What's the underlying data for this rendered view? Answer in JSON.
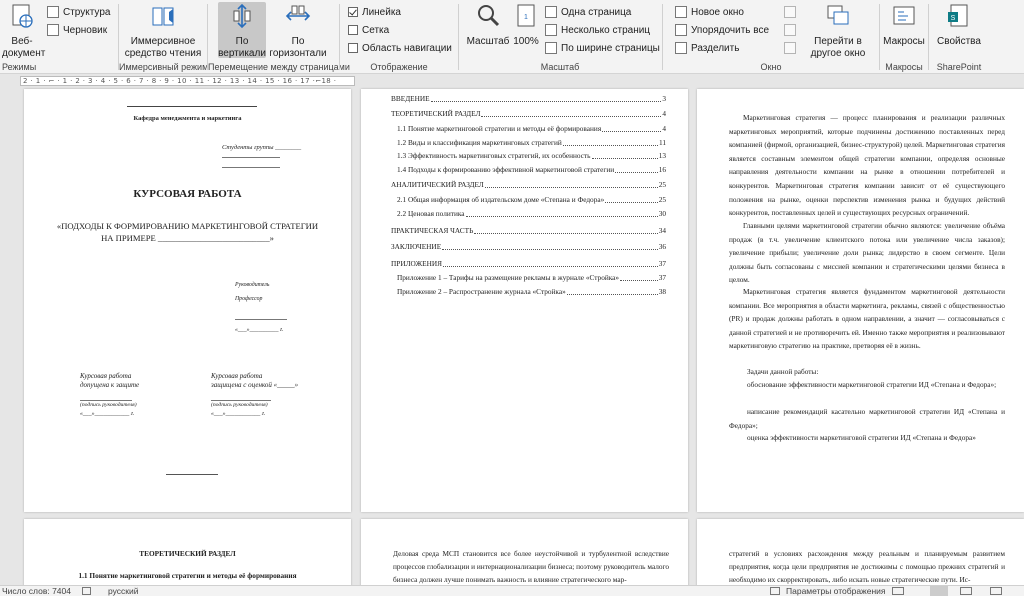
{
  "ribbon": {
    "modes": {
      "web_doc": "Веб-\nдокумент",
      "structure": "Структура",
      "draft": "Черновик",
      "group": "Режимы"
    },
    "immersive": {
      "reader": "Иммерсивное средство чтения",
      "group": "Иммерсивный режим"
    },
    "page_movement": {
      "vertical": "По вертикали",
      "horizontal": "По горизонтали",
      "group": "Перемещение между страницами"
    },
    "show": {
      "ruler": "Линейка",
      "grid": "Сетка",
      "nav_pane": "Область навигации",
      "group": "Отображение"
    },
    "zoom": {
      "zoom": "Масштаб",
      "hundred": "100%",
      "one_page": "Одна страница",
      "multiple_pages": "Несколько страниц",
      "page_width": "По ширине страницы",
      "group": "Масштаб"
    },
    "window": {
      "new_window": "Новое окно",
      "arrange_all": "Упорядочить все",
      "split": "Разделить",
      "switch_windows": "Перейти в другое окно",
      "group": "Окно"
    },
    "macros": {
      "macros": "Макросы",
      "group": "Макросы"
    },
    "sharepoint": {
      "properties": "Свойства",
      "group": "SharePoint"
    }
  },
  "ruler": {
    "text": "2 · 1 · ⌐ · 1 · 2 · 3 · 4 · 5 · 6 · 7 · 8 · 9 · 10 · 11 · 12 · 13 · 14 · 15 · 16 · 17 ·⌐18 ·"
  },
  "page1": {
    "dept": "Кафедра менеджмента и маркетинга",
    "student": "Студенты группы ________",
    "title": "КУРСОВАЯ РАБОТА",
    "topic_line1": "«ПОДХОДЫ К ФОРМИРОВАНИЮ МАРКЕТИНГОВОЙ СТРАТЕГИИ",
    "topic_line2": "НА ПРИМЕРЕ __________________________»",
    "supervisor": "Руководитель",
    "professor": "Профессор",
    "date_sig": "«___»__________ г.",
    "admitted_1": "Курсовая работа",
    "admitted_2": "допущена к защите",
    "defended_1": "Курсовая работа",
    "defended_2": "защищена с оценкой «_____»",
    "sup_sig_left": "(подпись руководителя)",
    "sup_sig_right": "(подпись руководителя)",
    "date_left": "«___»____________ г.",
    "date_right": "«___»____________ г."
  },
  "toc": [
    {
      "text": "ВВЕДЕНИЕ",
      "page": "3",
      "indent": 0
    },
    {
      "text": "ТЕОРЕТИЧЕСКИЙ РАЗДЕЛ",
      "page": "4",
      "indent": 0
    },
    {
      "text": "1.1 Понятие маркетинговой стратегии и методы её формирования",
      "page": "4",
      "indent": 1
    },
    {
      "text": "1.2 Виды и классификация маркетинговых стратегий",
      "page": "11",
      "indent": 1
    },
    {
      "text": "1.3 Эффективность маркетинговых стратегий, их особенность",
      "page": "13",
      "indent": 1
    },
    {
      "text": "1.4 Подходы к формированию эффективной маркетинговой стратегии",
      "page": "16",
      "indent": 1
    },
    {
      "text": "АНАЛИТИЧЕСКИЙ РАЗДЕЛ",
      "page": "25",
      "indent": 0
    },
    {
      "text": "2.1 Общая информация об издательском доме «Степана и Федора»",
      "page": "25",
      "indent": 1
    },
    {
      "text": "2.2 Ценовая политика",
      "page": "30",
      "indent": 1
    },
    {
      "text": "ПРАКТИЧЕСКАЯ ЧАСТЬ",
      "page": "34",
      "indent": 0
    },
    {
      "text": "ЗАКЛЮЧЕНИЕ",
      "page": "36",
      "indent": 0
    },
    {
      "text": "ПРИЛОЖЕНИЯ",
      "page": "37",
      "indent": 0
    },
    {
      "text": "Приложение 1 – Тарифы на размещение рекламы в журнале «Стройка»",
      "page": "37",
      "indent": 2
    },
    {
      "text": "Приложение 2 – Распространение журнала «Стройка»",
      "page": "38",
      "indent": 2
    }
  ],
  "page3": {
    "p1": "Маркетинговая стратегия — процесс планирования и реализации различных маркетинговых мероприятий, которые подчинены достижению поставленных перед компанией (фирмой, организацией, бизнес-структурой) целей. Маркетинговая стратегия является составным элементом общей стратегии компании, определяя основные направления деятельности компании на рынке в отношении потребителей и конкурентов. Маркетинговая стратегия компании зависит от её существующего положения на рынке, оценки перспектив изменения рынка и будущих действий конкурентов, поставленных целей и существующих ресурсных ограничений.",
    "p2": "Главными целями маркетинговой стратегии обычно являются: увеличение объёма продаж (в т.ч. увеличение клиентского потока или увеличение числа заказов); увеличение прибыли; увеличение доли рынка; лидерство в своем сегменте. Цели должны быть согласованы с миссией компании и стратегическими целями бизнеса в целом.",
    "p3": "Маркетинговая стратегия является фундаментом маркетинговой деятельности компании. Все мероприятия в области маркетинга, рекламы, связей с общественностью (PR) и продаж должны работать в одном направлении, а значит — согласовываться с данной стратегией и не противоречить ей. Именно также мероприятия и реализовывают маркетинговую стратегию на практике, претворяя её в жизнь.",
    "tasks": "Задачи данной работы:",
    "t1": "обоснование эффективности маркетинговой стратегии ИД «Степана и Федора»;",
    "t2": "написание рекомендаций касательно маркетинговой стратегии ИД «Степана и Федора»;",
    "t3": "оценка эффективности маркетинговой стратегии ИД «Степана и Федора»"
  },
  "page4": {
    "h1": "ТЕОРЕТИЧЕСКИЙ РАЗДЕЛ",
    "h2": "1.1 Понятие маркетинговой стратегии и методы её формирования"
  },
  "page5": {
    "text": "Деловая среда МСП становится все более неустойчивой и турбулентной вследствие процессов глобализации и интернационализации бизнеса; поэтому руководитель малого бизнеса должен лучше понимать важность и влияние стратегического мар-"
  },
  "page6": {
    "text": "стратегий в условиях расхождения между реальным и планируемым развитием предприятия, когда цели предприятия не достижимы с помощью прежних стратегий и необходимо их скорректировать, либо искать новые стратегические пути. Ис-"
  },
  "status": {
    "words": "Число слов: 7404",
    "lang": "русский",
    "display_settings": "Параметры отображения"
  }
}
